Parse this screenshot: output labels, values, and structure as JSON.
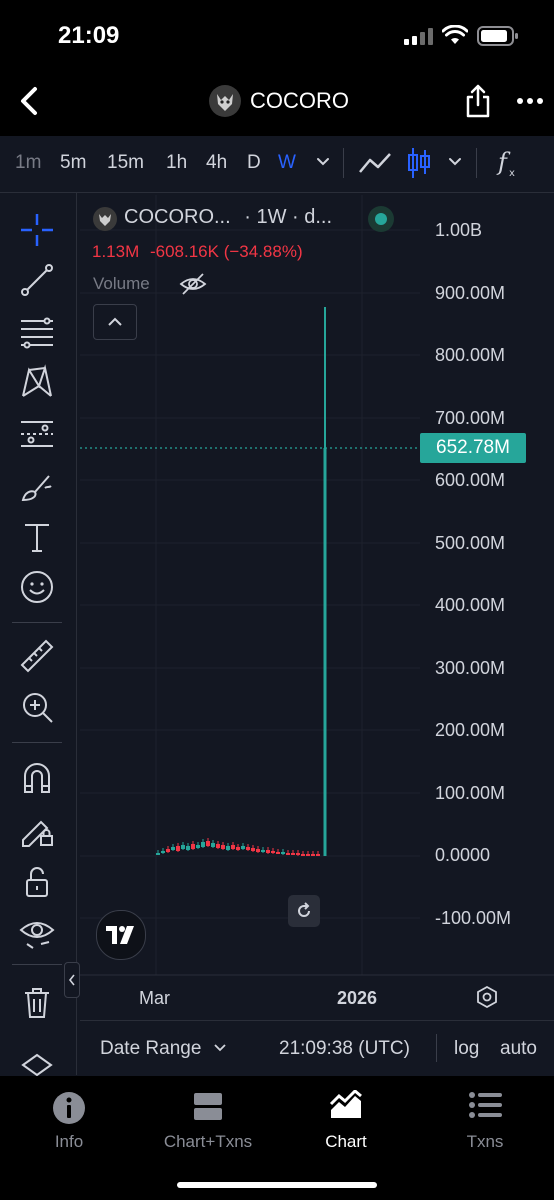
{
  "status_bar": {
    "time": "21:09"
  },
  "nav": {
    "title": "COCORO"
  },
  "timeframes": [
    "1m",
    "5m",
    "15m",
    "1h",
    "4h",
    "D",
    "W"
  ],
  "active_timeframe": "W",
  "legend": {
    "symbol": "COCORO...",
    "interval": "· 1W · d...",
    "last": "1.13M",
    "change": "-608.16K (−34.88%)",
    "volume_label": "Volume"
  },
  "price_axis": [
    "1.00B",
    "900.00M",
    "800.00M",
    "700.00M",
    "600.00M",
    "500.00M",
    "400.00M",
    "300.00M",
    "200.00M",
    "100.00M",
    "0.0000",
    "-100.00M"
  ],
  "current_price": "652.78M",
  "time_axis": {
    "label_1": "Mar",
    "label_2": "2026"
  },
  "bottom_bar": {
    "date_range": "Date Range",
    "clock": "21:09:38 (UTC)",
    "log": "log",
    "auto": "auto"
  },
  "tabs": [
    {
      "label": "Info"
    },
    {
      "label": "Chart+Txns"
    },
    {
      "label": "Chart"
    },
    {
      "label": "Txns"
    }
  ],
  "active_tab": "Chart",
  "colors": {
    "background": "#131722",
    "up": "#26a69a",
    "down": "#f23645",
    "accent": "#2962ff"
  }
}
